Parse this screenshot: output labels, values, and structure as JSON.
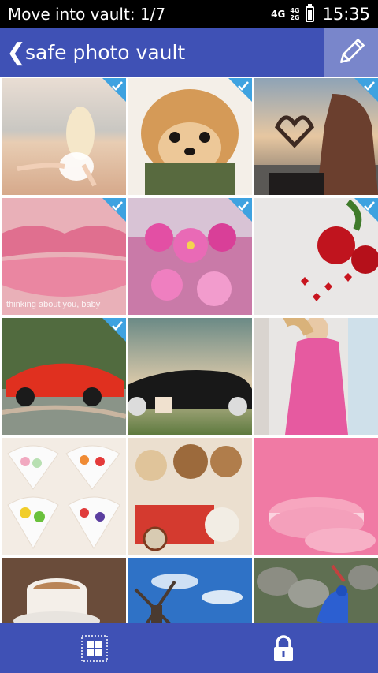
{
  "status_bar": {
    "title": "Move into vault: 1/7",
    "network_primary": "4G",
    "network_secondary_top": "4G",
    "network_secondary_bottom": "2G",
    "time": "15:35"
  },
  "header": {
    "back_icon": "chevron-left-icon",
    "title": "safe photo vault",
    "edit_icon": "pencil-icon",
    "accent_color": "#3f51b5",
    "edit_button_color": "#7986cb"
  },
  "photos": [
    {
      "subject": "beach girl",
      "selected": true
    },
    {
      "subject": "pomeranian puppy",
      "selected": true
    },
    {
      "subject": "heart hands",
      "selected": true
    },
    {
      "subject": "lips",
      "selected": true,
      "caption": "thinking about you, baby"
    },
    {
      "subject": "pink cosmos flowers",
      "selected": true
    },
    {
      "subject": "red roses",
      "selected": true
    },
    {
      "subject": "red sports car",
      "selected": true
    },
    {
      "subject": "black car",
      "selected": false
    },
    {
      "subject": "pink dress",
      "selected": false
    },
    {
      "subject": "candy hearts",
      "selected": false
    },
    {
      "subject": "teddy bears",
      "selected": false
    },
    {
      "subject": "pink macarons",
      "selected": false
    },
    {
      "subject": "coffee cup",
      "selected": false
    },
    {
      "subject": "windmill sky",
      "selected": false
    },
    {
      "subject": "peacock",
      "selected": false
    }
  ],
  "bottom_bar": {
    "left_icon": "select-all-grid-icon",
    "right_icon": "lock-icon"
  }
}
